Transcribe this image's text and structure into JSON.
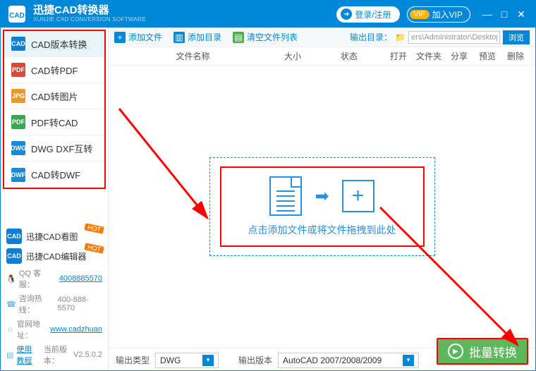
{
  "titlebar": {
    "app_name": "迅捷CAD转换器",
    "app_sub": "XUNJIE CAD CONVERSION SOFTWARE",
    "login": "登录/注册",
    "vip_badge": "VIP",
    "vip_text": "加入VIP"
  },
  "sidebar": {
    "items": [
      {
        "label": "CAD版本转换",
        "icon": "CAD",
        "color1": "#0e7fd4",
        "color2": "#0e7fd4"
      },
      {
        "label": "CAD转PDF",
        "icon": "PDF",
        "color1": "#d24a3a",
        "color2": "#d24a3a"
      },
      {
        "label": "CAD转图片",
        "icon": "JPG",
        "color1": "#e69a2e",
        "color2": "#e69a2e"
      },
      {
        "label": "PDF转CAD",
        "icon": "PDF",
        "color1": "#3aa757",
        "color2": "#3aa757"
      },
      {
        "label": "DWG DXF互转",
        "icon": "DWG",
        "color1": "#1b8ad4",
        "color2": "#1b8ad4"
      },
      {
        "label": "CAD转DWF",
        "icon": "DWF",
        "color1": "#1b8ad4",
        "color2": "#1b8ad4"
      }
    ],
    "extras": [
      {
        "label": "迅捷CAD看图",
        "hot": "HOT"
      },
      {
        "label": "迅捷CAD编辑器",
        "hot": "HOT"
      }
    ],
    "contacts": {
      "qq_label": "QQ 客服：",
      "qq": "4008885570",
      "phone_label": "咨询热线：",
      "phone": "400-888-5570",
      "site_label": "官网地址：",
      "site": "www.cadzhuan",
      "tutorial": "使用教程",
      "version_label": "当前版本：",
      "version": "V2.5.0.2"
    }
  },
  "toolbar": {
    "add_file": "添加文件",
    "add_folder": "添加目录",
    "clear_list": "清空文件列表",
    "output_dir_label": "输出目录：",
    "output_dir_value": "ers\\Administrator\\Desktop\\",
    "browse": "浏览"
  },
  "table_headers": {
    "name": "文件名称",
    "size": "大小",
    "status": "状态",
    "open": "打开",
    "folder": "文件夹",
    "share": "分享",
    "preview": "预览",
    "delete": "删除"
  },
  "dropzone": {
    "text": "点击添加文件或将文件拖拽到此处"
  },
  "bottom": {
    "out_type_label": "输出类型",
    "out_type_value": "DWG",
    "out_ver_label": "输出版本",
    "out_ver_value": "AutoCAD 2007/2008/2009"
  },
  "convert_button": "批量转换"
}
